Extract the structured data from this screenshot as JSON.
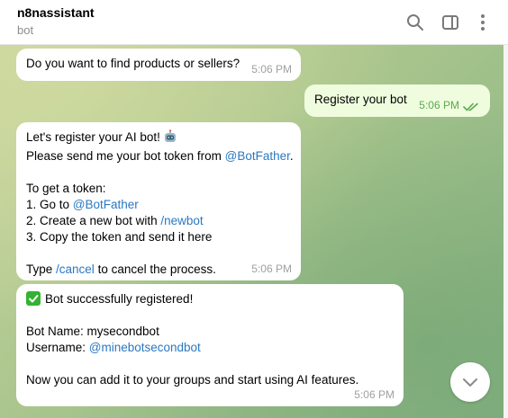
{
  "header": {
    "title": "n8nassistant",
    "subtitle": "bot",
    "icons": [
      "search-icon",
      "sidebar-toggle-icon",
      "more-vertical-icon"
    ]
  },
  "colors": {
    "link": "#2a78c2",
    "outgoing_bubble": "#effdde",
    "read_ticks": "#5da84f",
    "success_check": "#34b233"
  },
  "messages": [
    {
      "direction": "incoming",
      "text": "Do you want to find products or sellers?",
      "time": "5:06 PM"
    },
    {
      "direction": "outgoing",
      "text": "Register your bot",
      "time": "5:06 PM",
      "status": "read"
    },
    {
      "direction": "incoming",
      "time": "5:06 PM",
      "emoji": "robot-face",
      "lines": {
        "l1": "Let's register your AI bot!",
        "l2a": "Please send me your bot token from ",
        "l2link": "@BotFather",
        "l2b": ".",
        "l3": "To get a token:",
        "l4a": "1. Go to ",
        "l4link": "@BotFather",
        "l5a": "2. Create a new bot with ",
        "l5link": "/newbot",
        "l6": "3. Copy the token and send it here",
        "l7a": "Type ",
        "l7link": "/cancel",
        "l7b": " to cancel the process."
      }
    },
    {
      "direction": "incoming",
      "time": "5:06 PM",
      "emoji": "white-heavy-check-mark",
      "lines": {
        "l1": "Bot successfully registered!",
        "l2": "Bot Name: mysecondbot",
        "l3a": "Username: ",
        "l3link": "@minebotsecondbot",
        "l4": "Now you can add it to your groups and start using AI features."
      }
    }
  ],
  "scroll_down_button": {
    "icon": "chevron-down-icon"
  }
}
